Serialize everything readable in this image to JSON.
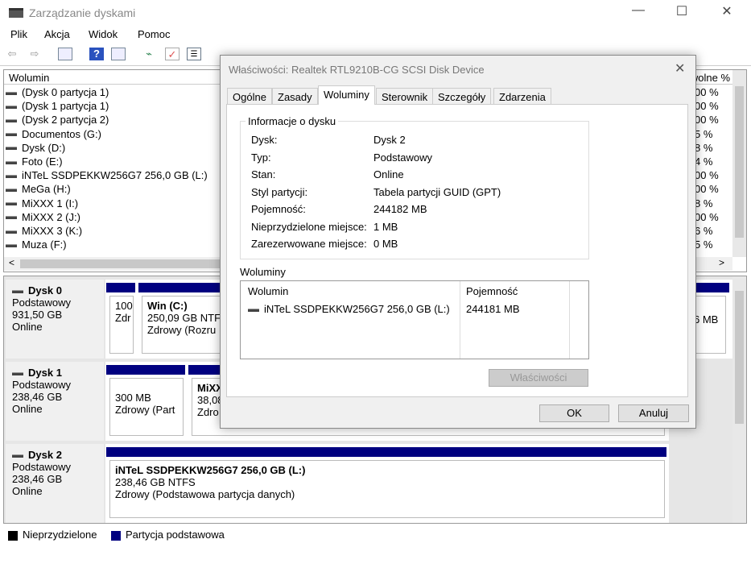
{
  "window": {
    "title": "Zarządzanie dyskami",
    "minimize": "—",
    "maximize": "☐",
    "close": "✕"
  },
  "menu": [
    "Plik",
    "Akcja",
    "Widok",
    "Pomoc"
  ],
  "toolbar": {
    "icons": [
      "back-icon",
      "forward-icon",
      "console-tree-icon",
      "help-icon",
      "action-pane-icon",
      "connect-icon",
      "properties-icon",
      "list-icon"
    ]
  },
  "volume_list": {
    "headers": {
      "volume": "Wolumin",
      "free_pct": "% wolne"
    },
    "rows": [
      {
        "name": "(Dysk 0 partycja 1)",
        "free": "00 %"
      },
      {
        "name": "(Dysk 1 partycja 1)",
        "free": "00 %"
      },
      {
        "name": "(Dysk 2 partycja 2)",
        "free": "00 %"
      },
      {
        "name": "Documentos (G:)",
        "free": "5 %"
      },
      {
        "name": "Dysk (D:)",
        "free": "8 %"
      },
      {
        "name": "Foto (E:)",
        "free": "4 %"
      },
      {
        "name": "iNTeL SSDPEKKW256G7 256,0 GB (L:)",
        "free": "00 %"
      },
      {
        "name": "MeGa (H:)",
        "free": "00 %"
      },
      {
        "name": "MiXXX 1 (I:)",
        "free": "8 %"
      },
      {
        "name": "MiXXX 2 (J:)",
        "free": "00 %"
      },
      {
        "name": "MiXXX 3 (K:)",
        "free": "6 %"
      },
      {
        "name": "Muza (F:)",
        "free": "5 %"
      }
    ]
  },
  "disks": [
    {
      "name": "Dysk 0",
      "type": "Podstawowy",
      "size": "931,50 GB",
      "status": "Online",
      "partitions": [
        {
          "l1": "100",
          "l2": "Zdr"
        },
        {
          "title": "Win  (C:)",
          "l1": "250,09 GB NTF",
          "l2": "Zdrowy (Rozru"
        },
        {
          "l1": "6 MB"
        }
      ]
    },
    {
      "name": "Dysk 1",
      "type": "Podstawowy",
      "size": "238,46 GB",
      "status": "Online",
      "partitions": [
        {
          "l1": "300 MB",
          "l2": "Zdrowy (Part"
        },
        {
          "title": "MiXX",
          "l1": "38,08",
          "l2": "Zdro"
        }
      ]
    },
    {
      "name": "Dysk 2",
      "type": "Podstawowy",
      "size": "238,46 GB",
      "status": "Online",
      "partitions": [
        {
          "title": "iNTeL SSDPEKKW256G7 256,0 GB  (L:)",
          "l1": "238,46 GB NTFS",
          "l2": "Zdrowy (Podstawowa partycja danych)"
        }
      ]
    }
  ],
  "legend": [
    {
      "label": "Nieprzydzielone",
      "color": "#000000"
    },
    {
      "label": "Partycja podstawowa",
      "color": "#000080"
    }
  ],
  "dialog": {
    "title": "Właściwości: Realtek RTL9210B-CG SCSI Disk Device",
    "tabs": [
      "Ogólne",
      "Zasady",
      "Woluminy",
      "Sterownik",
      "Szczegóły",
      "Zdarzenia"
    ],
    "active_tab": "Woluminy",
    "info_group": "Informacje o dysku",
    "info": [
      {
        "k": "Dysk:",
        "v": "Dysk 2"
      },
      {
        "k": "Typ:",
        "v": "Podstawowy"
      },
      {
        "k": "Stan:",
        "v": "Online"
      },
      {
        "k": "Styl partycji:",
        "v": "Tabela partycji GUID (GPT)"
      },
      {
        "k": "Pojemność:",
        "v": "244182 MB"
      },
      {
        "k": "Nieprzydzielone miejsce:",
        "v": "1 MB"
      },
      {
        "k": "Zarezerwowane miejsce:",
        "v": "0 MB"
      }
    ],
    "volumes_label": "Woluminy",
    "volumes_headers": {
      "volume": "Wolumin",
      "capacity": "Pojemność"
    },
    "volumes": [
      {
        "name": "iNTeL SSDPEKKW256G7 256,0 GB (L:)",
        "capacity": "244181 MB"
      }
    ],
    "properties_button": "Właściwości",
    "ok": "OK",
    "cancel": "Anuluj"
  }
}
